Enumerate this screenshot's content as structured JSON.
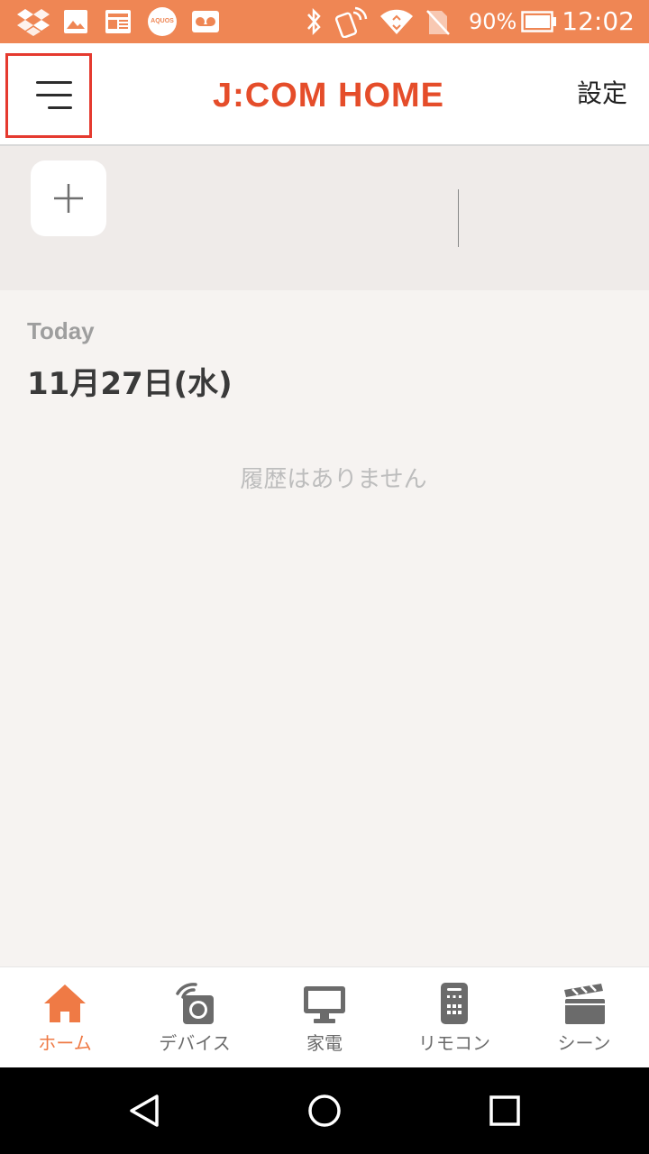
{
  "status_bar": {
    "battery": "90%",
    "time": "12:02",
    "notification_icons": [
      "dropbox-icon",
      "gallery-icon",
      "news-icon",
      "aquos-icon",
      "voicemail-icon"
    ],
    "system_icons": [
      "bluetooth-icon",
      "nfc-icon",
      "wifi-icon",
      "no-sim-icon",
      "battery-icon"
    ],
    "aquos_text": "AQUOS"
  },
  "header": {
    "logo": "J:COM HOME",
    "settings": "設定",
    "menu_icon": "hamburger-menu-icon"
  },
  "device_strip": {
    "add_icon": "plus-icon"
  },
  "history": {
    "today_label": "Today",
    "date": "11月27日(水)",
    "empty_message": "履歴はありません"
  },
  "tabs": [
    {
      "label": "ホーム",
      "icon": "home-icon",
      "active": true
    },
    {
      "label": "デバイス",
      "icon": "device-icon",
      "active": false
    },
    {
      "label": "家電",
      "icon": "monitor-icon",
      "active": false
    },
    {
      "label": "リモコン",
      "icon": "remote-icon",
      "active": false
    },
    {
      "label": "シーン",
      "icon": "clapperboard-icon",
      "active": false
    }
  ],
  "nav_bar": {
    "back_icon": "back-triangle-icon",
    "home_icon": "home-circle-icon",
    "recents_icon": "recents-square-icon"
  },
  "colors": {
    "status_bar": "#ef8654",
    "accent": "#ef7a45",
    "logo": "#e54d2a",
    "highlight": "#e53a2f",
    "background": "#f6f3f1",
    "tab_inactive": "#6b6b6b"
  }
}
